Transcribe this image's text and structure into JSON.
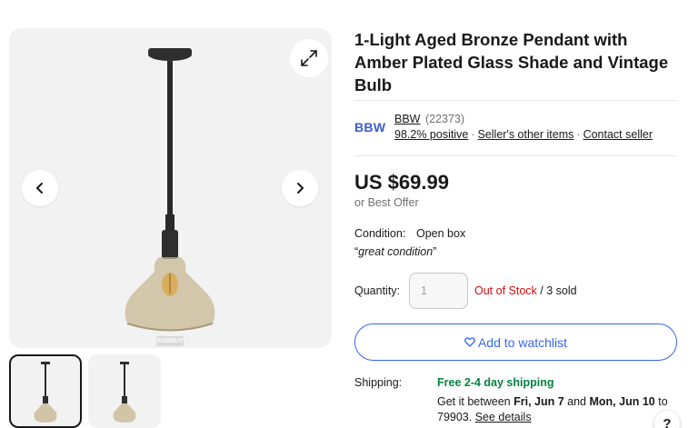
{
  "gallery": {
    "expand_icon": "expand-icon",
    "prev_icon": "chevron-left-icon",
    "next_icon": "chevron-right-icon",
    "watermark": "SUBBUY"
  },
  "product": {
    "title": "1-Light Aged Bronze Pendant with Amber Plated Glass Shade and Vintage Bulb",
    "price": "US $69.99",
    "best_offer": "or Best Offer",
    "condition_label": "Condition:",
    "condition_value": "Open box",
    "condition_note": "great condition",
    "quantity_label": "Quantity:",
    "quantity_value": "1",
    "stock_status": "Out of Stock",
    "sold_count": "/ 3 sold",
    "watchlist_label": "Add to watchlist"
  },
  "seller": {
    "logo_text": "BBW",
    "name": "BBW",
    "feedback_count": "(22373)",
    "positive": "98.2% positive",
    "other_items": "Seller's other items",
    "contact": "Contact seller"
  },
  "shipping": {
    "label": "Shipping:",
    "free": "Free 2-4 day shipping",
    "get_it": "Get it between",
    "date_from": "Fri, Jun 7",
    "and": "and",
    "date_to": "Mon, Jun 10",
    "to": "to",
    "zip": "79903.",
    "see_details": "See details"
  },
  "help": {
    "label": "?"
  },
  "colors": {
    "accent": "#3665f3",
    "out_of_stock": "#d50b0b",
    "free_shipping": "#05823f"
  }
}
